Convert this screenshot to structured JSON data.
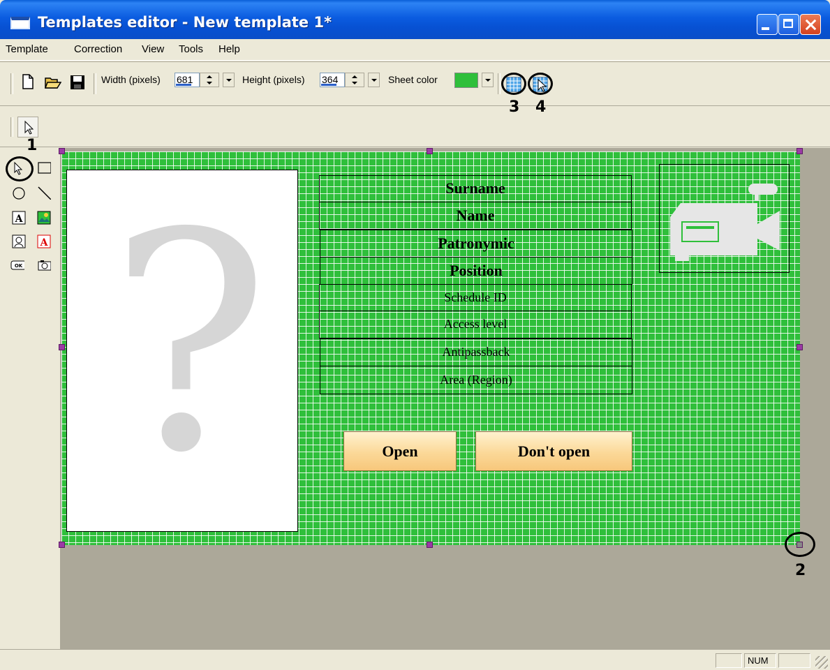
{
  "window": {
    "title": "Templates editor - New template 1*"
  },
  "menu": {
    "items": [
      "Template",
      "Correction",
      "View",
      "Tools",
      "Help"
    ]
  },
  "toolbar": {
    "width_label": "Width (pixels)",
    "width_value": "681",
    "height_label": "Height (pixels)",
    "height_value": "364",
    "sheet_color_label": "Sheet color",
    "sheet_color": "#2fbf3b"
  },
  "callouts": [
    "1",
    "2",
    "3",
    "4"
  ],
  "template": {
    "fields": [
      "Surname",
      "Name",
      "Patronymic",
      "Position",
      "Schedule ID",
      "Access level",
      "Antipassback",
      "Area (Region)"
    ],
    "photo_placeholder": "?",
    "buttons": {
      "open": "Open",
      "dont_open": "Don't open"
    }
  },
  "statusbar": {
    "num": "NUM"
  },
  "icons": {
    "new": "new-document-icon",
    "open": "open-folder-icon",
    "save": "save-disk-icon",
    "grid": "grid-icon",
    "snap": "snap-to-grid-icon",
    "pointer": "pointer-arrow-icon",
    "camera": "video-camera-icon"
  }
}
